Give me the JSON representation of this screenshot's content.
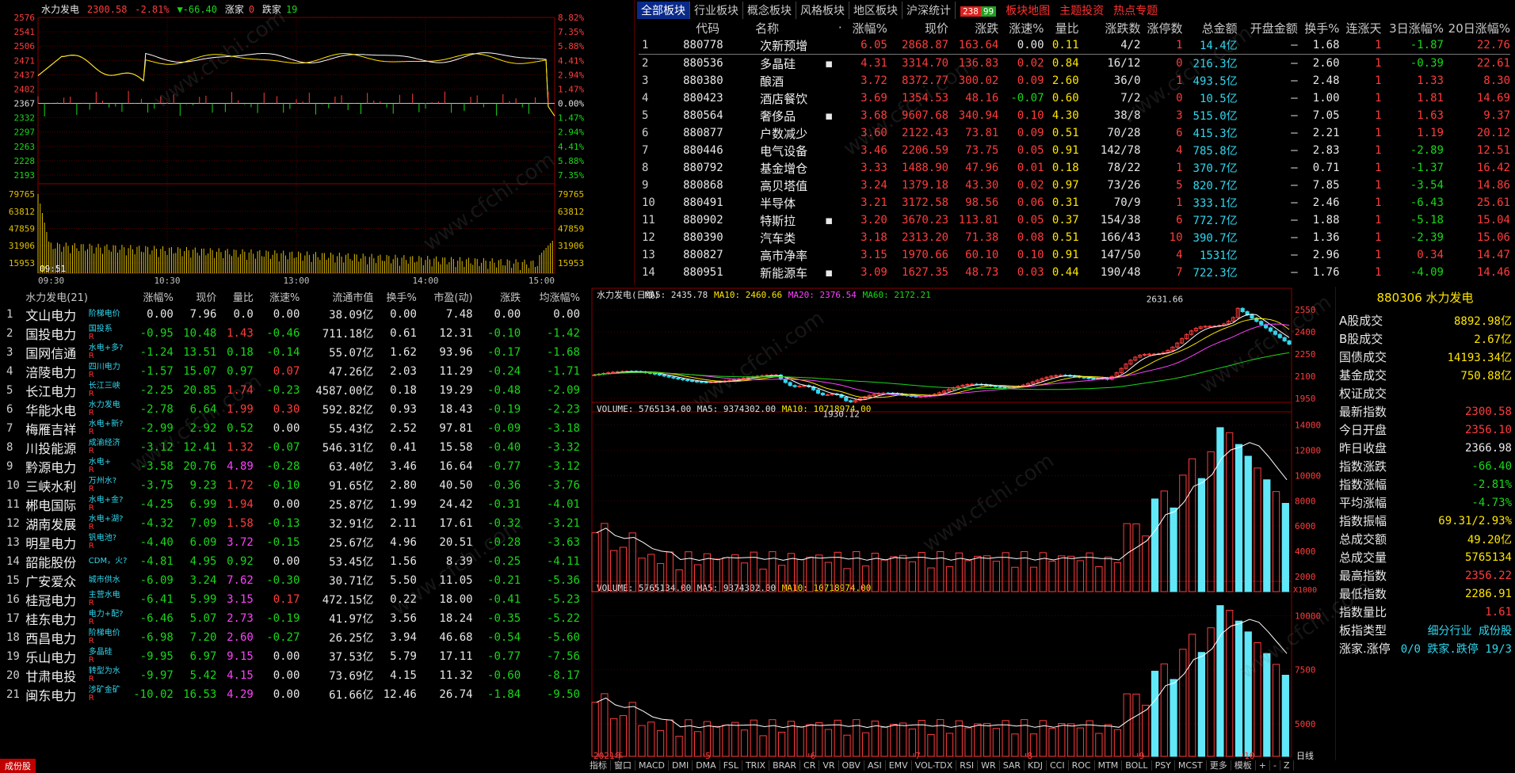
{
  "intraday": {
    "name": "水力发电",
    "price": "2300.58",
    "change_pct": "-2.81%",
    "change": "▼-66.40",
    "up_label": "涨家",
    "up_count": "0",
    "down_label": "跌家",
    "down_count": "19",
    "price_ticks": [
      "2576",
      "2541",
      "2506",
      "2471",
      "2437",
      "2402",
      "2367",
      "2332",
      "2297",
      "2263",
      "2228",
      "2193"
    ],
    "pct_ticks": [
      "8.82%",
      "7.35%",
      "5.88%",
      "4.41%",
      "2.94%",
      "1.47%",
      "0.00%",
      "1.47%",
      "2.94%",
      "4.41%",
      "5.88%",
      "7.35%"
    ],
    "vol_ticks": [
      "79765",
      "63812",
      "47859",
      "31906",
      "15953"
    ],
    "time_ticks": [
      "09:30",
      "10:30",
      "13:00",
      "14:00",
      "15:00"
    ],
    "time_marker": "09:51"
  },
  "tabs": {
    "items": [
      "全部板块",
      "行业板块",
      "概念板块",
      "风格板块",
      "地区板块",
      "沪深统计"
    ],
    "badge_up": "238",
    "badge_down": "99",
    "right_items": [
      "板块地图",
      "主题投资",
      "热点专题"
    ]
  },
  "sector_table": {
    "headers": [
      "代码",
      "名称",
      "·",
      "涨幅%",
      "现价",
      "涨跌",
      "涨速%",
      "量比",
      "涨跌数",
      "涨停数",
      "总金额",
      "开盘金额",
      "换手%",
      "连涨天",
      "3日涨幅%",
      "20日涨幅%"
    ],
    "rows": [
      {
        "i": "1",
        "code": "880778",
        "name": "次新预增",
        "mark": "",
        "pct": "6.05",
        "price": "2868.87",
        "chg": "163.64",
        "speed": "0.00",
        "vr": "0.11",
        "ud": "4/2",
        "lim": "1",
        "amt": "14.4亿",
        "open": "–",
        "turn": "1.68",
        "days": "1",
        "d3": "-1.87",
        "d20": "22.76"
      },
      {
        "i": "2",
        "code": "880536",
        "name": "多晶硅",
        "mark": "▪",
        "pct": "4.31",
        "price": "3314.70",
        "chg": "136.83",
        "speed": "0.02",
        "vr": "0.84",
        "ud": "16/12",
        "lim": "0",
        "amt": "216.3亿",
        "open": "–",
        "turn": "2.60",
        "days": "1",
        "d3": "-0.39",
        "d20": "22.61"
      },
      {
        "i": "3",
        "code": "880380",
        "name": "酿酒",
        "mark": "",
        "pct": "3.72",
        "price": "8372.77",
        "chg": "300.02",
        "speed": "0.09",
        "vr": "2.60",
        "ud": "36/0",
        "lim": "1",
        "amt": "493.5亿",
        "open": "–",
        "turn": "2.48",
        "days": "1",
        "d3": "1.33",
        "d20": "8.30"
      },
      {
        "i": "4",
        "code": "880423",
        "name": "酒店餐饮",
        "mark": "",
        "pct": "3.69",
        "price": "1354.53",
        "chg": "48.16",
        "speed": "-0.07",
        "vr": "0.60",
        "ud": "7/2",
        "lim": "0",
        "amt": "10.5亿",
        "open": "–",
        "turn": "1.00",
        "days": "1",
        "d3": "1.81",
        "d20": "14.69"
      },
      {
        "i": "5",
        "code": "880564",
        "name": "奢侈品",
        "mark": "▪",
        "pct": "3.68",
        "price": "9607.68",
        "chg": "340.94",
        "speed": "0.10",
        "vr": "4.30",
        "ud": "38/8",
        "lim": "3",
        "amt": "515.0亿",
        "open": "–",
        "turn": "7.05",
        "days": "1",
        "d3": "1.63",
        "d20": "9.37"
      },
      {
        "i": "6",
        "code": "880877",
        "name": "户数减少",
        "mark": "",
        "pct": "3.60",
        "price": "2122.43",
        "chg": "73.81",
        "speed": "0.09",
        "vr": "0.51",
        "ud": "70/28",
        "lim": "6",
        "amt": "415.3亿",
        "open": "–",
        "turn": "2.21",
        "days": "1",
        "d3": "1.19",
        "d20": "20.12"
      },
      {
        "i": "7",
        "code": "880446",
        "name": "电气设备",
        "mark": "",
        "pct": "3.46",
        "price": "2206.59",
        "chg": "73.75",
        "speed": "0.05",
        "vr": "0.91",
        "ud": "142/78",
        "lim": "4",
        "amt": "785.8亿",
        "open": "–",
        "turn": "2.83",
        "days": "1",
        "d3": "-2.89",
        "d20": "12.51"
      },
      {
        "i": "8",
        "code": "880792",
        "name": "基金增仓",
        "mark": "",
        "pct": "3.33",
        "price": "1488.90",
        "chg": "47.96",
        "speed": "0.01",
        "vr": "0.18",
        "ud": "78/22",
        "lim": "1",
        "amt": "370.7亿",
        "open": "–",
        "turn": "0.71",
        "days": "1",
        "d3": "-1.37",
        "d20": "16.42"
      },
      {
        "i": "9",
        "code": "880868",
        "name": "高贝塔值",
        "mark": "",
        "pct": "3.24",
        "price": "1379.18",
        "chg": "43.30",
        "speed": "0.02",
        "vr": "0.97",
        "ud": "73/26",
        "lim": "5",
        "amt": "820.7亿",
        "open": "–",
        "turn": "7.85",
        "days": "1",
        "d3": "-3.54",
        "d20": "14.86"
      },
      {
        "i": "10",
        "code": "880491",
        "name": "半导体",
        "mark": "",
        "pct": "3.21",
        "price": "3172.58",
        "chg": "98.56",
        "speed": "0.06",
        "vr": "0.31",
        "ud": "70/9",
        "lim": "1",
        "amt": "333.1亿",
        "open": "–",
        "turn": "2.46",
        "days": "1",
        "d3": "-6.43",
        "d20": "25.61"
      },
      {
        "i": "11",
        "code": "880902",
        "name": "特斯拉",
        "mark": "▪",
        "pct": "3.20",
        "price": "3670.23",
        "chg": "113.81",
        "speed": "0.05",
        "vr": "0.37",
        "ud": "154/38",
        "lim": "6",
        "amt": "772.7亿",
        "open": "–",
        "turn": "1.88",
        "days": "1",
        "d3": "-5.18",
        "d20": "15.04"
      },
      {
        "i": "12",
        "code": "880390",
        "name": "汽车类",
        "mark": "",
        "pct": "3.18",
        "price": "2313.20",
        "chg": "71.38",
        "speed": "0.08",
        "vr": "0.51",
        "ud": "166/43",
        "lim": "10",
        "amt": "390.7亿",
        "open": "–",
        "turn": "1.36",
        "days": "1",
        "d3": "-2.39",
        "d20": "15.06"
      },
      {
        "i": "13",
        "code": "880827",
        "name": "高市净率",
        "mark": "",
        "pct": "3.15",
        "price": "1970.66",
        "chg": "60.10",
        "speed": "0.10",
        "vr": "0.91",
        "ud": "147/50",
        "lim": "4",
        "amt": "1531亿",
        "open": "–",
        "turn": "2.96",
        "days": "1",
        "d3": "0.34",
        "d20": "14.47"
      },
      {
        "i": "14",
        "code": "880951",
        "name": "新能源车",
        "mark": "▪",
        "pct": "3.09",
        "price": "1627.35",
        "chg": "48.73",
        "speed": "0.03",
        "vr": "0.44",
        "ud": "190/48",
        "lim": "7",
        "amt": "722.3亿",
        "open": "–",
        "turn": "1.76",
        "days": "1",
        "d3": "-4.09",
        "d20": "14.46"
      }
    ]
  },
  "stock_table": {
    "title": "水力发电(21)",
    "headers": [
      "涨幅%",
      "现价",
      "量比",
      "涨速%",
      "流通市值",
      "换手%",
      "市盈(动)",
      "涨跌",
      "均涨幅%"
    ],
    "rows": [
      {
        "i": "1",
        "name": "文山电力",
        "tag": "阶梯电价",
        "r": "",
        "pct": "0.00",
        "price": "7.96",
        "vr": "0.0",
        "speed": "0.00",
        "cap": "38.09亿",
        "turn": "0.00",
        "pe": "7.48",
        "chg": "0.00",
        "avg": "0.00"
      },
      {
        "i": "2",
        "name": "国投电力",
        "tag": "国投系",
        "r": "R",
        "pct": "-0.95",
        "price": "10.48",
        "vr": "1.43",
        "speed": "-0.46",
        "cap": "711.18亿",
        "turn": "0.61",
        "pe": "12.31",
        "chg": "-0.10",
        "avg": "-1.42"
      },
      {
        "i": "3",
        "name": "国网信通",
        "tag": "水电+多?",
        "r": "R",
        "pct": "-1.24",
        "price": "13.51",
        "vr": "0.18",
        "speed": "-0.14",
        "cap": "55.07亿",
        "turn": "1.62",
        "pe": "93.96",
        "chg": "-0.17",
        "avg": "-1.68"
      },
      {
        "i": "4",
        "name": "涪陵电力",
        "tag": "四川电力",
        "r": "R",
        "pct": "-1.57",
        "price": "15.07",
        "vr": "0.97",
        "speed": "0.07",
        "cap": "47.26亿",
        "turn": "2.03",
        "pe": "11.29",
        "chg": "-0.24",
        "avg": "-1.71"
      },
      {
        "i": "5",
        "name": "长江电力",
        "tag": "长江三峡",
        "r": "R",
        "pct": "-2.25",
        "price": "20.85",
        "vr": "1.74",
        "speed": "-0.23",
        "cap": "4587.00亿",
        "turn": "0.18",
        "pe": "19.29",
        "chg": "-0.48",
        "avg": "-2.09"
      },
      {
        "i": "6",
        "name": "华能水电",
        "tag": "水力发电",
        "r": "R",
        "pct": "-2.78",
        "price": "6.64",
        "vr": "1.99",
        "speed": "0.30",
        "cap": "592.82亿",
        "turn": "0.93",
        "pe": "18.43",
        "chg": "-0.19",
        "avg": "-2.23"
      },
      {
        "i": "7",
        "name": "梅雁吉祥",
        "tag": "水电+新?",
        "r": "R",
        "pct": "-2.99",
        "price": "2.92",
        "vr": "0.52",
        "speed": "0.00",
        "cap": "55.43亿",
        "turn": "2.52",
        "pe": "97.81",
        "chg": "-0.09",
        "avg": "-3.18"
      },
      {
        "i": "8",
        "name": "川投能源",
        "tag": "成渝经济",
        "r": "R",
        "pct": "-3.12",
        "price": "12.41",
        "vr": "1.32",
        "speed": "-0.07",
        "cap": "546.31亿",
        "turn": "0.41",
        "pe": "15.58",
        "chg": "-0.40",
        "avg": "-3.32"
      },
      {
        "i": "9",
        "name": "黔源电力",
        "tag": "水电+",
        "r": "R",
        "pct": "-3.58",
        "price": "20.76",
        "vr": "4.89",
        "speed": "-0.28",
        "cap": "63.40亿",
        "turn": "3.46",
        "pe": "16.64",
        "chg": "-0.77",
        "avg": "-3.12"
      },
      {
        "i": "10",
        "name": "三峡水利",
        "tag": "万州水?",
        "r": "R",
        "pct": "-3.75",
        "price": "9.23",
        "vr": "1.72",
        "speed": "-0.10",
        "cap": "91.65亿",
        "turn": "2.80",
        "pe": "40.50",
        "chg": "-0.36",
        "avg": "-3.76"
      },
      {
        "i": "11",
        "name": "郴电国际",
        "tag": "水电+金?",
        "r": "R",
        "pct": "-4.25",
        "price": "6.99",
        "vr": "1.94",
        "speed": "0.00",
        "cap": "25.87亿",
        "turn": "1.99",
        "pe": "24.42",
        "chg": "-0.31",
        "avg": "-4.01"
      },
      {
        "i": "12",
        "name": "湖南发展",
        "tag": "水电+湖?",
        "r": "R",
        "pct": "-4.32",
        "price": "7.09",
        "vr": "1.58",
        "speed": "-0.13",
        "cap": "32.91亿",
        "turn": "2.11",
        "pe": "17.61",
        "chg": "-0.32",
        "avg": "-3.21"
      },
      {
        "i": "13",
        "name": "明星电力",
        "tag": "钒电池?",
        "r": "R",
        "pct": "-4.40",
        "price": "6.09",
        "vr": "3.72",
        "speed": "-0.15",
        "cap": "25.67亿",
        "turn": "4.96",
        "pe": "20.51",
        "chg": "-0.28",
        "avg": "-3.63"
      },
      {
        "i": "14",
        "name": "韶能股份",
        "tag": "CDM，火?",
        "r": "",
        "pct": "-4.81",
        "price": "4.95",
        "vr": "0.92",
        "speed": "0.00",
        "cap": "53.45亿",
        "turn": "1.56",
        "pe": "8.39",
        "chg": "-0.25",
        "avg": "-4.11"
      },
      {
        "i": "15",
        "name": "广安爱众",
        "tag": "城市供水",
        "r": "",
        "pct": "-6.09",
        "price": "3.24",
        "vr": "7.62",
        "speed": "-0.30",
        "cap": "30.71亿",
        "turn": "5.50",
        "pe": "11.05",
        "chg": "-0.21",
        "avg": "-5.36"
      },
      {
        "i": "16",
        "name": "桂冠电力",
        "tag": "主营水电",
        "r": "R",
        "pct": "-6.41",
        "price": "5.99",
        "vr": "3.15",
        "speed": "0.17",
        "cap": "472.15亿",
        "turn": "0.22",
        "pe": "18.00",
        "chg": "-0.41",
        "avg": "-5.23"
      },
      {
        "i": "17",
        "name": "桂东电力",
        "tag": "电力+配?",
        "r": "R",
        "pct": "-6.46",
        "price": "5.07",
        "vr": "2.73",
        "speed": "-0.19",
        "cap": "41.97亿",
        "turn": "3.56",
        "pe": "18.24",
        "chg": "-0.35",
        "avg": "-5.22"
      },
      {
        "i": "18",
        "name": "西昌电力",
        "tag": "阶梯电价",
        "r": "R",
        "pct": "-6.98",
        "price": "7.20",
        "vr": "2.60",
        "speed": "-0.27",
        "cap": "26.25亿",
        "turn": "3.94",
        "pe": "46.68",
        "chg": "-0.54",
        "avg": "-5.60"
      },
      {
        "i": "19",
        "name": "乐山电力",
        "tag": "多晶硅",
        "r": "R",
        "pct": "-9.95",
        "price": "6.97",
        "vr": "9.15",
        "speed": "0.00",
        "cap": "37.53亿",
        "turn": "5.79",
        "pe": "17.11",
        "chg": "-0.77",
        "avg": "-7.56"
      },
      {
        "i": "20",
        "name": "甘肃电投",
        "tag": "转型为水",
        "r": "R",
        "pct": "-9.97",
        "price": "5.42",
        "vr": "4.15",
        "speed": "0.00",
        "cap": "73.69亿",
        "turn": "4.15",
        "pe": "11.32",
        "chg": "-0.60",
        "avg": "-8.17"
      },
      {
        "i": "21",
        "name": "闽东电力",
        "tag": "涉矿金矿",
        "r": "R",
        "pct": "-10.02",
        "price": "16.53",
        "vr": "4.29",
        "speed": "0.00",
        "cap": "61.66亿",
        "turn": "12.46",
        "pe": "26.74",
        "chg": "-1.84",
        "avg": "-9.50"
      }
    ]
  },
  "kline": {
    "title": "水力发电(日线)",
    "ma5": "MA5: 2435.78",
    "ma10": "MA10: 2460.66",
    "ma20": "MA20: 2376.54",
    "ma60": "MA60: 2172.21",
    "high_label": "2631.66",
    "low_label": "1930.12",
    "price_ticks": [
      "2550",
      "2400",
      "2250",
      "2100",
      "1950"
    ],
    "vol_title": "VOLUME: 5765134.00",
    "vol_ma5": "MA5: 9374302.00",
    "vol_ma10": "MA10: 10718974.00",
    "vol_ticks1": [
      "14000",
      "12000",
      "10000",
      "8000",
      "6000",
      "4000",
      "2000"
    ],
    "vol_ticks2": [
      "10000",
      "7500",
      "5000"
    ],
    "unit": "X1000",
    "date_ticks": [
      "2021年",
      "5",
      "6",
      "7",
      "8",
      "9",
      "10"
    ],
    "period": "日线"
  },
  "info_panel": {
    "title": "880306 水力发电",
    "rows": [
      {
        "k": "A股成交",
        "v": "8892.98亿"
      },
      {
        "k": "B股成交",
        "v": "2.67亿"
      },
      {
        "k": "国债成交",
        "v": "14193.34亿"
      },
      {
        "k": "基金成交",
        "v": "750.88亿"
      },
      {
        "k": "权证成交",
        "v": ""
      },
      {
        "k": "最新指数",
        "v": "2300.58"
      },
      {
        "k": "今日开盘",
        "v": "2356.10"
      },
      {
        "k": "昨日收盘",
        "v": "2366.98"
      },
      {
        "k": "指数涨跌",
        "v": "-66.40"
      },
      {
        "k": "指数涨幅",
        "v": "-2.81%"
      },
      {
        "k": "平均涨幅",
        "v": "-4.73%"
      },
      {
        "k": "指数振幅",
        "v": "69.31/2.93%"
      },
      {
        "k": "总成交额",
        "v": "49.20亿"
      },
      {
        "k": "总成交量",
        "v": "5765134"
      },
      {
        "k": "最高指数",
        "v": "2356.22"
      },
      {
        "k": "最低指数",
        "v": "2286.91"
      },
      {
        "k": "指数量比",
        "v": "1.61"
      },
      {
        "k": "板指类型",
        "v": "细分行业 成份股"
      },
      {
        "k": "涨家.涨停",
        "v": "0/0 跌家.跌停 19/3"
      }
    ]
  },
  "footer": {
    "tag": "成份股",
    "items": [
      "指标",
      "窗口",
      "MACD",
      "DMI",
      "DMA",
      "FSL",
      "TRIX",
      "BRAR",
      "CR",
      "VR",
      "OBV",
      "ASI",
      "EMV",
      "VOL-TDX",
      "RSI",
      "WR",
      "SAR",
      "KDJ",
      "CCI",
      "ROC",
      "MTM",
      "BOLL",
      "PSY",
      "MCST",
      "更多",
      "模板",
      "+",
      "-",
      "Z"
    ]
  },
  "watermark": "www.cfchi.com"
}
